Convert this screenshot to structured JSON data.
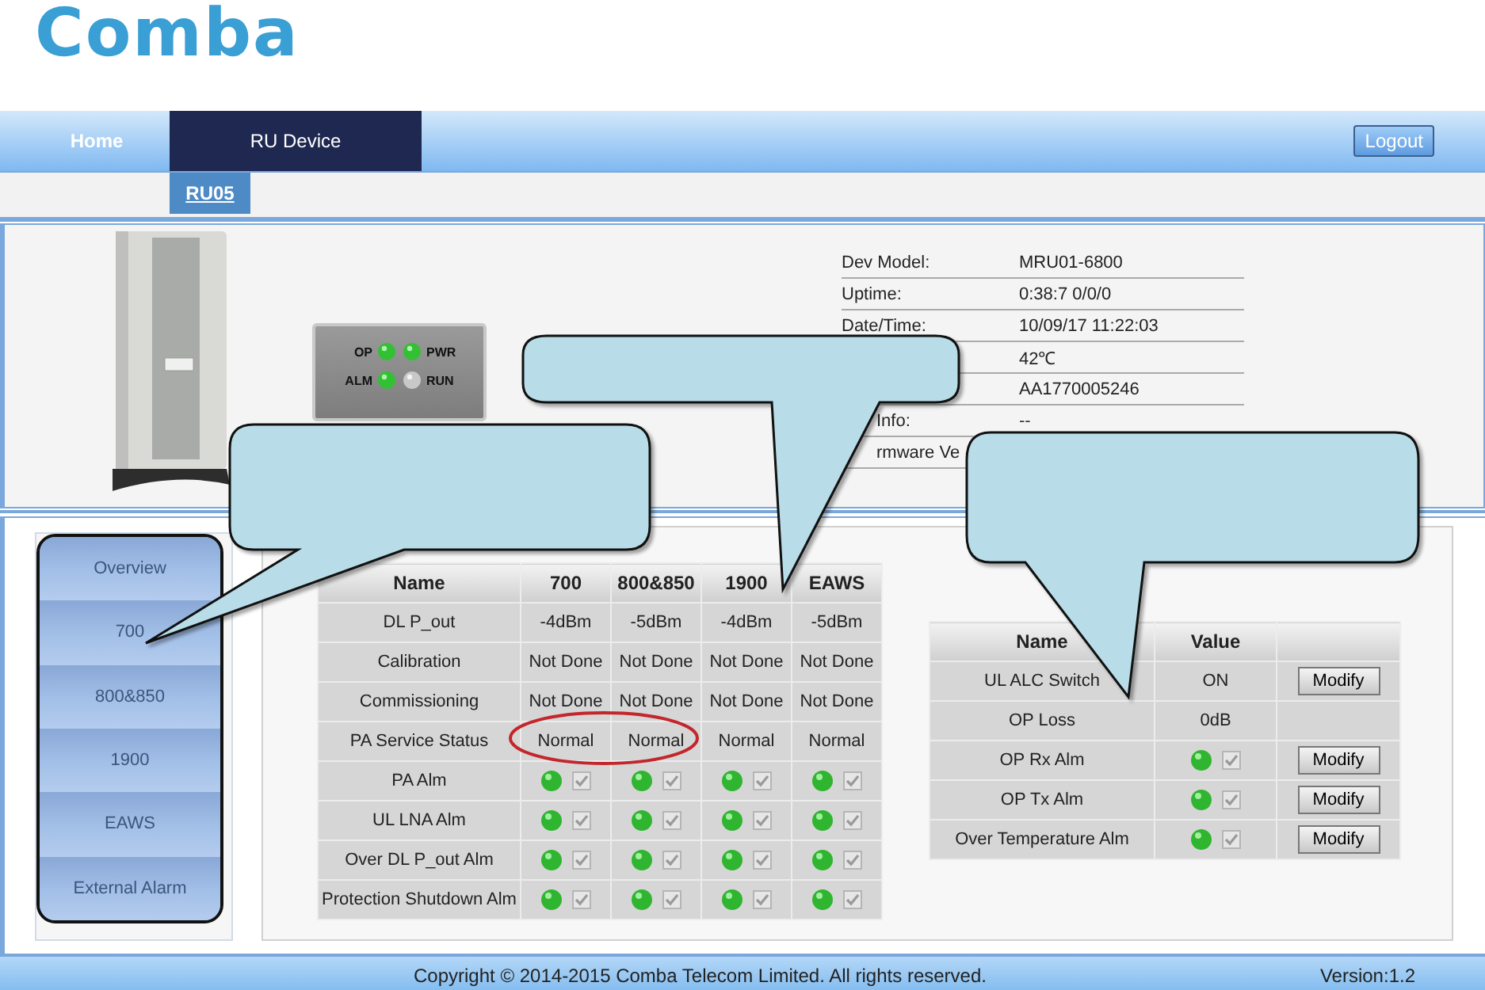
{
  "logo": "Comba",
  "nav": {
    "tabs": [
      {
        "label": "Home",
        "selected": false
      },
      {
        "label": "RU Device",
        "selected": true
      }
    ],
    "logout": "Logout"
  },
  "subnav": {
    "tabs": [
      {
        "label": "RU05",
        "selected": true
      }
    ]
  },
  "device": {
    "leds": [
      {
        "label": "OP",
        "on": true
      },
      {
        "label": "PWR",
        "on": true
      },
      {
        "label": "ALM",
        "on": true
      },
      {
        "label": "RUN",
        "on": false
      }
    ],
    "info": [
      {
        "kind": "full",
        "label": "Dev Model:",
        "value": "MRU01-6800"
      },
      {
        "kind": "full",
        "label": "Uptime:",
        "value": "0:38:7 0/0/0"
      },
      {
        "kind": "full",
        "label": "Date/Time:",
        "value": "10/09/17 11:22:03"
      },
      {
        "kind": "full",
        "value": "42℃"
      },
      {
        "kind": "full",
        "value": "AA1770005246"
      },
      {
        "kind": "partial",
        "label": "Info:",
        "value": "--"
      },
      {
        "kind": "partial",
        "label": "rmware Ve"
      }
    ]
  },
  "sidebar": {
    "items": [
      "Overview",
      "700",
      "800&850",
      "1900",
      "EAWS",
      "External Alarm"
    ]
  },
  "band_table": {
    "columns": [
      "Name",
      "700",
      "800&850",
      "1900",
      "EAWS"
    ],
    "rows": [
      {
        "cells": [
          {
            "kind": "name",
            "text": "DL P_out"
          },
          {
            "kind": "text",
            "text": "-4dBm"
          },
          {
            "kind": "text",
            "text": "-5dBm"
          },
          {
            "kind": "text",
            "text": "-4dBm"
          },
          {
            "kind": "text",
            "text": "-5dBm"
          }
        ]
      },
      {
        "cells": [
          {
            "kind": "name",
            "text": "Calibration"
          },
          {
            "kind": "text",
            "text": "Not Done"
          },
          {
            "kind": "text",
            "text": "Not Done"
          },
          {
            "kind": "text",
            "text": "Not Done"
          },
          {
            "kind": "text",
            "text": "Not Done"
          }
        ]
      },
      {
        "cells": [
          {
            "kind": "name",
            "text": "Commissioning"
          },
          {
            "kind": "text",
            "text": "Not Done"
          },
          {
            "kind": "text",
            "text": "Not Done"
          },
          {
            "kind": "text",
            "text": "Not Done"
          },
          {
            "kind": "text",
            "text": "Not Done"
          }
        ]
      },
      {
        "cells": [
          {
            "kind": "name",
            "text": "PA Service Status"
          },
          {
            "kind": "text",
            "text": "Normal"
          },
          {
            "kind": "text",
            "text": "Normal"
          },
          {
            "kind": "text",
            "text": "Normal"
          },
          {
            "kind": "text",
            "text": "Normal"
          }
        ]
      },
      {
        "cells": [
          {
            "kind": "name",
            "text": "PA Alm"
          },
          {
            "kind": "alarm",
            "on": true,
            "checked": true
          },
          {
            "kind": "alarm",
            "on": true,
            "checked": true
          },
          {
            "kind": "alarm",
            "on": true,
            "checked": true
          },
          {
            "kind": "alarm",
            "on": true,
            "checked": true
          }
        ]
      },
      {
        "cells": [
          {
            "kind": "name",
            "text": "UL LNA Alm"
          },
          {
            "kind": "alarm",
            "on": true,
            "checked": true
          },
          {
            "kind": "alarm",
            "on": true,
            "checked": true
          },
          {
            "kind": "alarm",
            "on": true,
            "checked": true
          },
          {
            "kind": "alarm",
            "on": true,
            "checked": true
          }
        ]
      },
      {
        "cells": [
          {
            "kind": "name",
            "text": "Over DL P_out Alm"
          },
          {
            "kind": "alarm",
            "on": true,
            "checked": true
          },
          {
            "kind": "alarm",
            "on": true,
            "checked": true
          },
          {
            "kind": "alarm",
            "on": true,
            "checked": true
          },
          {
            "kind": "alarm",
            "on": true,
            "checked": true
          }
        ]
      },
      {
        "cells": [
          {
            "kind": "name",
            "text": "Protection Shutdown Alm"
          },
          {
            "kind": "alarm",
            "on": true,
            "checked": true
          },
          {
            "kind": "alarm",
            "on": true,
            "checked": true
          },
          {
            "kind": "alarm",
            "on": true,
            "checked": true
          },
          {
            "kind": "alarm",
            "on": true,
            "checked": true
          }
        ]
      }
    ]
  },
  "param_table": {
    "columns": [
      "Name",
      "Value"
    ],
    "rows": [
      {
        "cells": [
          {
            "kind": "name",
            "text": "UL ALC Switch"
          },
          {
            "kind": "text",
            "text": "ON"
          },
          {
            "kind": "button",
            "text": "Modify"
          }
        ]
      },
      {
        "cells": [
          {
            "kind": "name",
            "text": "OP Loss"
          },
          {
            "kind": "text",
            "text": "0dB"
          }
        ]
      },
      {
        "cells": [
          {
            "kind": "name",
            "text": "OP Rx Alm"
          },
          {
            "kind": "alarm",
            "on": true,
            "checked": true
          },
          {
            "kind": "button",
            "text": "Modify"
          }
        ]
      },
      {
        "cells": [
          {
            "kind": "name",
            "text": "OP Tx Alm"
          },
          {
            "kind": "alarm",
            "on": true,
            "checked": true
          },
          {
            "kind": "button",
            "text": "Modify"
          }
        ]
      },
      {
        "cells": [
          {
            "kind": "name",
            "text": "Over Temperature Alm"
          },
          {
            "kind": "alarm",
            "on": true,
            "checked": true
          },
          {
            "kind": "button",
            "text": "Modify"
          }
        ]
      }
    ]
  },
  "annotations": [
    {
      "kind": "callout"
    },
    {
      "kind": "callout"
    },
    {
      "kind": "callout"
    },
    {
      "kind": "ellipse"
    }
  ],
  "footer": {
    "copyright": "Copyright © 2014-2015 Comba Telecom Limited. All rights reserved.",
    "version": "Version:1.2"
  }
}
